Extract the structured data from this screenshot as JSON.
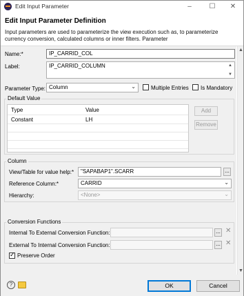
{
  "window": {
    "title": "Edit Input Parameter",
    "controls": {
      "minimize": "–",
      "maximize": "☐",
      "close": "✕"
    }
  },
  "header": {
    "title": "Edit Input Parameter Definition",
    "description": "Input parameters are used to parameterize the view execution such as, to parameterize currency conversion, calculated columns or inner filters. Parameter"
  },
  "form": {
    "name_label": "Name:*",
    "name_value": "IP_CARRID_COL",
    "label_label": "Label:",
    "label_value": "IP_CARRID_COLUMN",
    "param_type_label": "Parameter Type:",
    "param_type_value": "Column",
    "multiple_entries_label": "Multiple Entries",
    "multiple_entries_checked": false,
    "is_mandatory_label": "Is Mandatory",
    "is_mandatory_checked": false
  },
  "default_value": {
    "title": "Default Value",
    "columns": [
      "Type",
      "Value"
    ],
    "rows": [
      {
        "type": "Constant",
        "value": "LH"
      }
    ],
    "add_label": "Add",
    "remove_label": "Remove"
  },
  "column": {
    "title": "Column",
    "view_table_label": "View/Table for value help:*",
    "view_table_value": "\"SAPABAP1\".SCARR",
    "ref_column_label": "Reference Column:*",
    "ref_column_value": "CARRID",
    "hierarchy_label": "Hierarchy:",
    "hierarchy_value": "<None>"
  },
  "conversion": {
    "title": "Conversion Functions",
    "int_to_ext_label": "Internal To External Conversion Function:",
    "int_to_ext_value": "",
    "ext_to_int_label": "External To Internal Conversion Function:",
    "ext_to_int_value": "",
    "preserve_order_label": "Preserve Order",
    "preserve_order_checked": true
  },
  "footer": {
    "ok_label": "OK",
    "cancel_label": "Cancel"
  },
  "icons": {
    "help": "help-icon",
    "folder": "folder-icon",
    "dropdown": "chevron-down-icon",
    "clear": "clear-x-icon",
    "browse": "browse-ellipsis"
  }
}
